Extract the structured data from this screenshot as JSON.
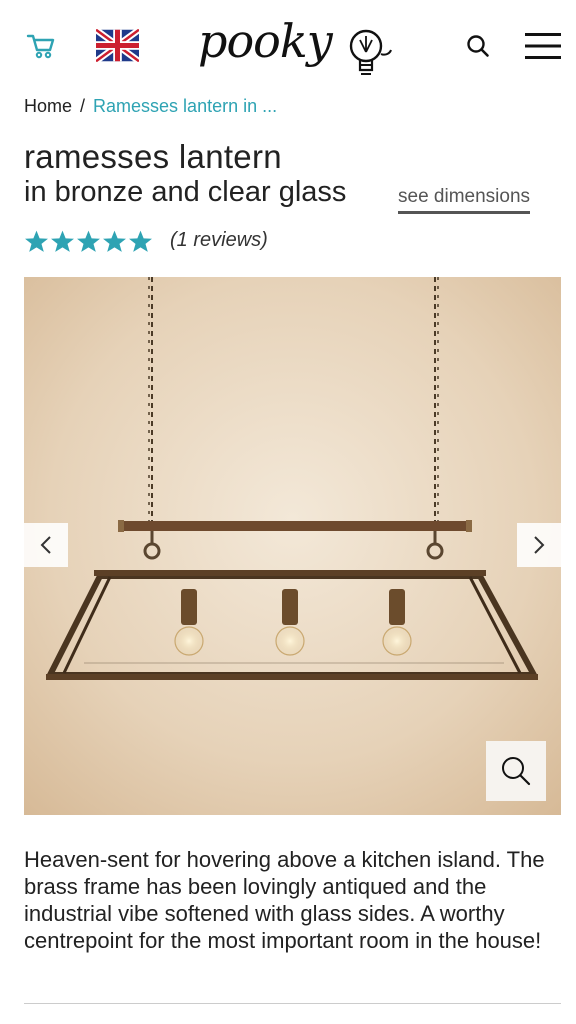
{
  "header": {
    "logo_text": "pooky",
    "icons": {
      "cart": "cart-icon",
      "flag": "uk-flag-icon",
      "search": "search-icon",
      "menu": "hamburger-menu-icon"
    },
    "accent_color": "#2ea3b3"
  },
  "breadcrumb": {
    "home": "Home",
    "separator": "/",
    "current": "Ramesses lantern in ..."
  },
  "product": {
    "title": "ramesses lantern",
    "subtitle": "in bronze and clear glass",
    "dimensions_link": "see dimensions",
    "rating": 5,
    "max_rating": 5,
    "reviews": "(1 reviews)",
    "star_color": "#2ea3b3"
  },
  "gallery": {
    "prev_icon": "chevron-left-icon",
    "next_icon": "chevron-right-icon",
    "zoom_icon": "magnifier-icon"
  },
  "description": "Heaven-sent for hovering above a kitchen island. The brass frame has been lovingly antiqued and the industrial vibe softened with glass sides. A worthy centrepoint for the most important room in the house!"
}
